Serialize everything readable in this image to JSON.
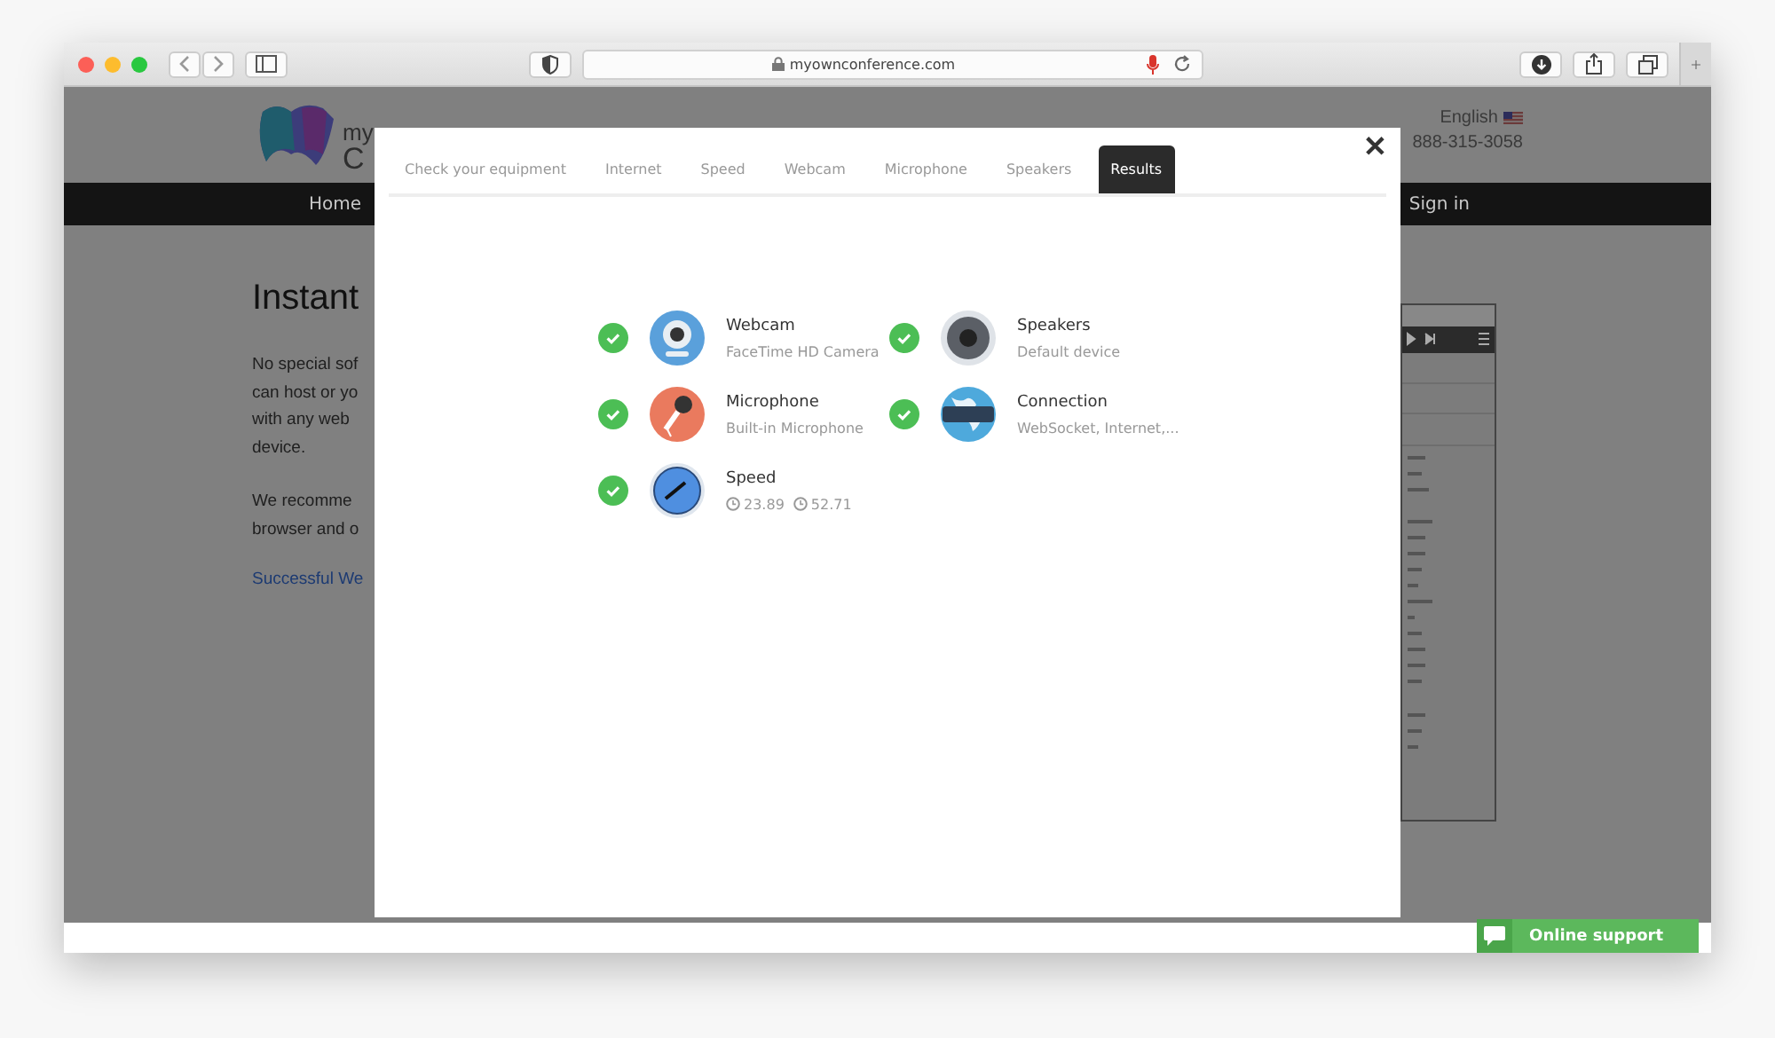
{
  "browser": {
    "url": "myownconference.com"
  },
  "site": {
    "logo_text": [
      "my",
      "C"
    ],
    "language": "English",
    "phone": "888-315-3058",
    "nav": [
      "Home",
      "Sign in"
    ],
    "heading": "Instant",
    "paragraphs": [
      [
        "No special sof",
        "can host or yo",
        "with any web",
        "device."
      ],
      [
        "We recomme",
        "browser and o"
      ]
    ],
    "link": "Successful We",
    "support": "Online support"
  },
  "modal": {
    "tabs": [
      {
        "label": "Check your equipment",
        "selected": false
      },
      {
        "label": "Internet",
        "selected": false
      },
      {
        "label": "Speed",
        "selected": false
      },
      {
        "label": "Webcam",
        "selected": false
      },
      {
        "label": "Microphone",
        "selected": false
      },
      {
        "label": "Speakers",
        "selected": false
      },
      {
        "label": "Results",
        "selected": true
      }
    ],
    "close": "✕",
    "results": [
      {
        "kind": "webcam",
        "title": "Webcam",
        "detail": "FaceTime HD Camera",
        "passed": true
      },
      {
        "kind": "speakers",
        "title": "Speakers",
        "detail": "Default device",
        "passed": true
      },
      {
        "kind": "microphone",
        "title": "Microphone",
        "detail": "Built-in Microphone",
        "passed": true
      },
      {
        "kind": "connection",
        "title": "Connection",
        "detail": "WebSocket, Internet,...",
        "passed": true
      },
      {
        "kind": "speed",
        "title": "Speed",
        "readings": [
          "23.89",
          "52.71"
        ],
        "passed": true
      }
    ]
  }
}
